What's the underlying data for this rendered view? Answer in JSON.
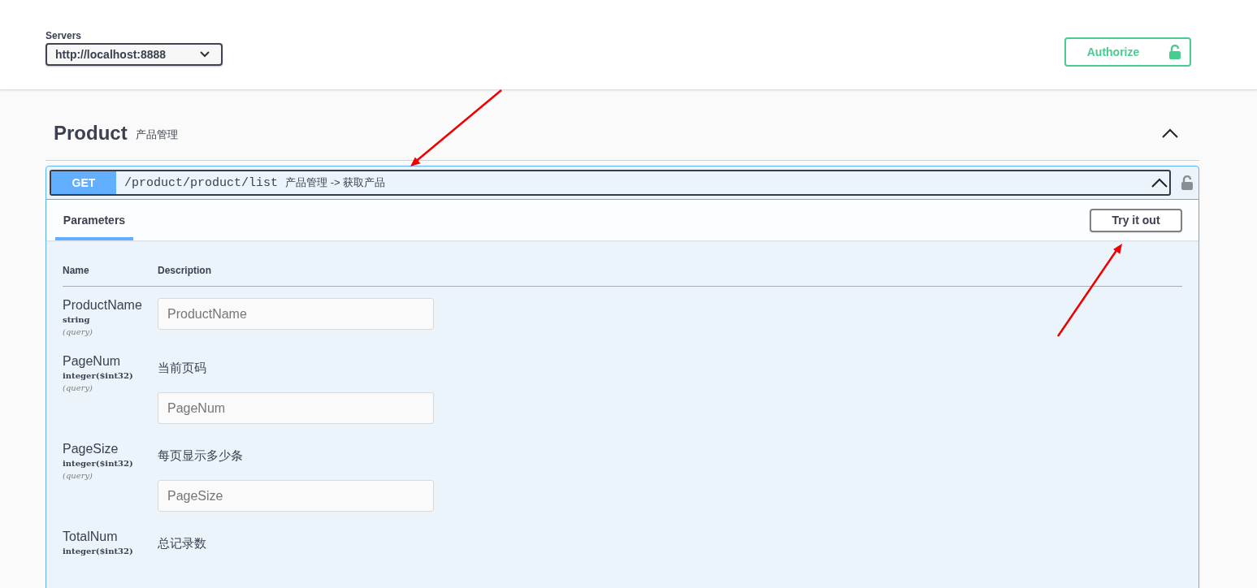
{
  "servers": {
    "label": "Servers",
    "value": "http://localhost:8888"
  },
  "authorize": {
    "label": "Authorize"
  },
  "tag": {
    "name": "Product",
    "description": "产品管理",
    "expanded": true
  },
  "operation": {
    "method": "GET",
    "path": "/product/product/list",
    "summary": "产品管理 -> 获取产品",
    "expanded": true,
    "locked": false,
    "tabs": [
      {
        "label": "Parameters",
        "selected": true
      }
    ],
    "try_button": "Try it out",
    "columns": [
      "Name",
      "Description"
    ],
    "parameters": [
      {
        "name": "ProductName",
        "type": "string",
        "location": "(query)",
        "placeholder": "ProductName"
      },
      {
        "name": "PageNum",
        "type": "integer($int32)",
        "location": "(query)",
        "description": "当前页码",
        "placeholder": "PageNum"
      },
      {
        "name": "PageSize",
        "type": "integer($int32)",
        "location": "(query)",
        "description": "每页显示多少条",
        "placeholder": "PageSize"
      },
      {
        "name": "TotalNum",
        "type": "integer($int32)",
        "description": "总记录数"
      }
    ]
  },
  "annotations": [
    {
      "kind": "arrow"
    },
    {
      "kind": "arrow"
    }
  ]
}
